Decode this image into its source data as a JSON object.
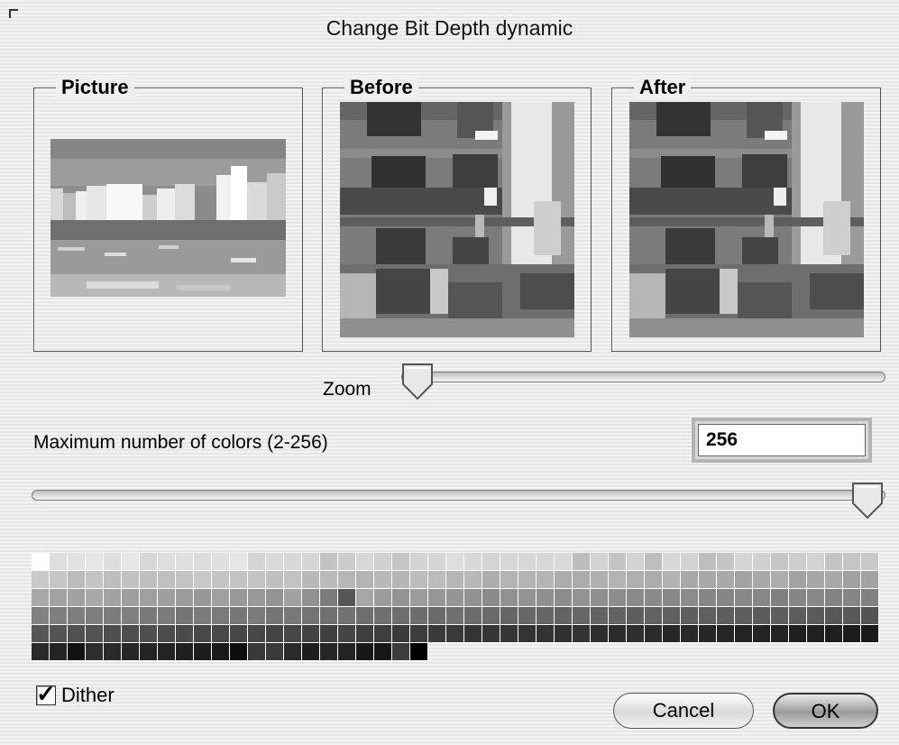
{
  "window": {
    "title": "Change Bit Depth dynamic"
  },
  "groups": {
    "picture_label": "Picture",
    "before_label": "Before",
    "after_label": "After"
  },
  "zoom": {
    "label": "Zoom",
    "level": 0.0
  },
  "colors": {
    "label": "Maximum number of colors (2-256)",
    "value": "256",
    "slider_level": 1.0
  },
  "dither": {
    "label": "Dither",
    "checked": true
  },
  "buttons": {
    "cancel": "Cancel",
    "ok": "OK"
  },
  "palette": {
    "count": 256,
    "colors": [
      "#ffffff",
      "#dddddd",
      "#e2e2e2",
      "#e6e6e6",
      "#dedede",
      "#e7e7e7",
      "#d8d8d8",
      "#dedede",
      "#e0e0e0",
      "#dcdcdc",
      "#e0e0e0",
      "#e6e6e6",
      "#d5d5d5",
      "#d9d9d9",
      "#d8d8d8",
      "#d6d6d6",
      "#c4c4c4",
      "#cccccc",
      "#d8d8d8",
      "#d1d1d1",
      "#c5c5c5",
      "#d3d3d3",
      "#d6d6d6",
      "#dedede",
      "#d8d8d8",
      "#d4d4d4",
      "#d7d7d7",
      "#d7d7d7",
      "#d7d7d7",
      "#dadada",
      "#bdbdbd",
      "#d3d3d3",
      "#c4c4c4",
      "#d2d2d2",
      "#bebebe",
      "#d8d8d8",
      "#d3d3d3",
      "#bebebe",
      "#c5c5c5",
      "#d6d6d6",
      "#d0d0d0",
      "#c6c6c6",
      "#cdcdcd",
      "#d2d2d2",
      "#c4c4c4",
      "#c5c5c5",
      "#c9c9c9",
      "#c9c9c9",
      "#c6c6c6",
      "#bbbbbb",
      "#c4c4c4",
      "#bebebe",
      "#c2c2c2",
      "#bfbfbf",
      "#c0c0c0",
      "#c3c3c3",
      "#c7c7c7",
      "#c4c4c4",
      "#c3c3c3",
      "#c3c3c3",
      "#bfbfbf",
      "#c2c2c2",
      "#b9b9b9",
      "#bbbbbb",
      "#b7b7b7",
      "#b3b3b3",
      "#b9b9b9",
      "#b6b6b6",
      "#bdbdbd",
      "#bcbcbc",
      "#b6b6b6",
      "#b8b8b8",
      "#aeaeae",
      "#b3b3b3",
      "#b4b4b4",
      "#b4b4b4",
      "#acacac",
      "#acacac",
      "#b0b0b0",
      "#b3b3b3",
      "#afafaf",
      "#acacac",
      "#b2b2b2",
      "#a8a8a8",
      "#a9a9a9",
      "#a9a9a9",
      "#a3a3a3",
      "#a9a9a9",
      "#aeaeae",
      "#a2a2a2",
      "#a6a6a6",
      "#a9a9a9",
      "#a1a1a1",
      "#a3a3a3",
      "#a8a8a8",
      "#a2a2a2",
      "#a1a1a1",
      "#a8a8a8",
      "#a3a3a3",
      "#9e9e9e",
      "#9f9f9f",
      "#9e9e9e",
      "#9b9b9b",
      "#989898",
      "#a0a0a0",
      "#999999",
      "#999999",
      "#939393",
      "#a1a1a1",
      "#909090",
      "#7c7c7c",
      "#565656",
      "#a6a6a6",
      "#9c9c9c",
      "#939393",
      "#9b9b9b",
      "#969696",
      "#959595",
      "#919191",
      "#8b8b8b",
      "#919191",
      "#939393",
      "#8f8f8f",
      "#8d8d8d",
      "#939393",
      "#8f8f8f",
      "#8d8d8d",
      "#898989",
      "#8a8a8a",
      "#888888",
      "#8b8b8b",
      "#868686",
      "#868686",
      "#888888",
      "#878787",
      "#808080",
      "#868686",
      "#888888",
      "#838383",
      "#858585",
      "#818181",
      "#828282",
      "#7e7e7e",
      "#7d7d7d",
      "#7d7d7d",
      "#7c7c7c",
      "#7f7f7f",
      "#797979",
      "#7a7a7a",
      "#747474",
      "#7a7a7a",
      "#7a7a7a",
      "#777777",
      "#7a7a7a",
      "#757575",
      "#787878",
      "#737373",
      "#707070",
      "#727272",
      "#6e6e6e",
      "#6f6f6f",
      "#6e6e6e",
      "#6d6d6d",
      "#6a6a6a",
      "#6f6f6f",
      "#6b6b6b",
      "#6a6a6a",
      "#656565",
      "#676767",
      "#666666",
      "#646464",
      "#666666",
      "#636363",
      "#636363",
      "#5e5e5e",
      "#626262",
      "#606060",
      "#5e5e5e",
      "#5f5f5f",
      "#5c5c5c",
      "#5e5e5e",
      "#5b5b5b",
      "#5e5e5e",
      "#5c5c5c",
      "#5a5a5a",
      "#575757",
      "#585858",
      "#545454",
      "#565656",
      "#545454",
      "#515151",
      "#525252",
      "#4e4e4e",
      "#4d4d4d",
      "#4f4f4f",
      "#4c4c4c",
      "#4b4b4b",
      "#474747",
      "#484848",
      "#464646",
      "#474747",
      "#444444",
      "#464646",
      "#424242",
      "#404040",
      "#454545",
      "#3f3f3f",
      "#3e3e3e",
      "#3b3b3b",
      "#3c3c3c",
      "#3a3a3a",
      "#393939",
      "#353535",
      "#363636",
      "#363636",
      "#343434",
      "#333333",
      "#303030",
      "#333333",
      "#2e2e2e",
      "#2c2c2c",
      "#2d2d2d",
      "#2b2b2b",
      "#272727",
      "#292929",
      "#262626",
      "#252525",
      "#232323",
      "#242424",
      "#222222",
      "#1f1f1f",
      "#202020",
      "#1e1e1e",
      "#1c1c1c",
      "#1a1a1a",
      "#2a2a2a",
      "#242424",
      "#111111",
      "#2e2e2e",
      "#2a2a2a",
      "#262626",
      "#242424",
      "#222222",
      "#202020",
      "#1c1c1c",
      "#1a1a1a",
      "#0e0e0e",
      "#383838",
      "#3a3a3a",
      "#2a2a2a",
      "#1e1e1e",
      "#262626",
      "#222222",
      "#181818",
      "#161616",
      "#3c3c3c",
      "#000000"
    ]
  }
}
